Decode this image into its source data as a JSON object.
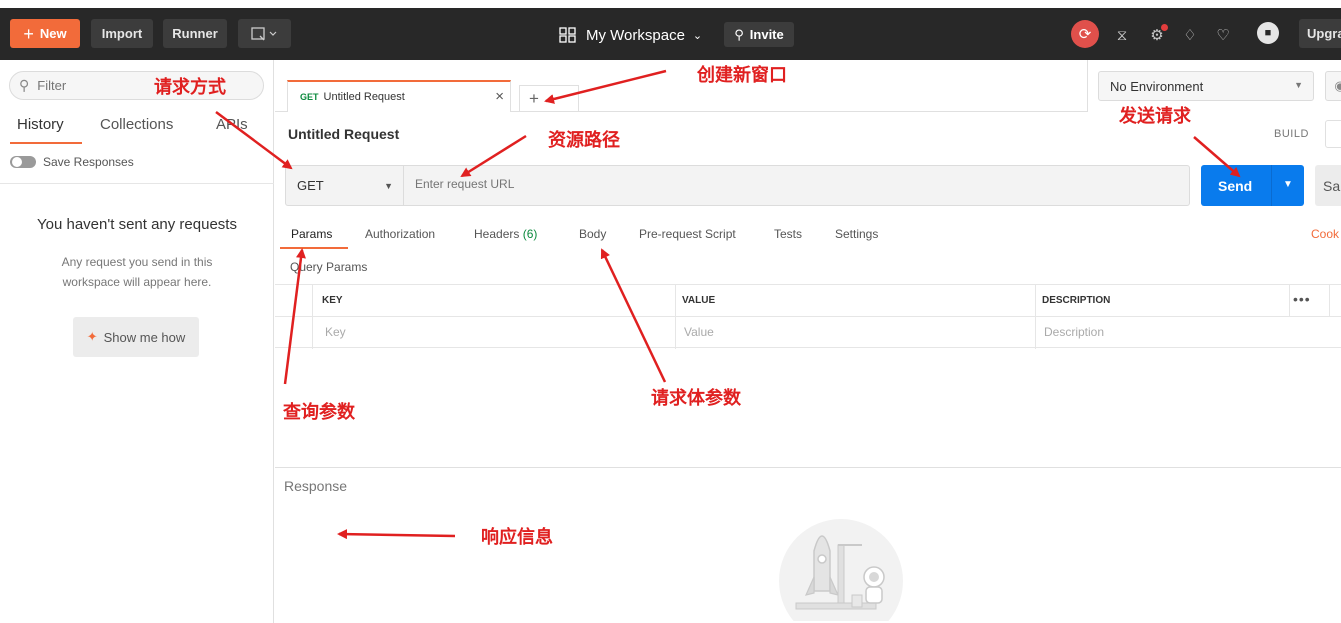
{
  "header": {
    "new_label": "New",
    "import_label": "Import",
    "runner_label": "Runner",
    "workspace_label": "My Workspace",
    "invite_label": "Invite",
    "upgrade_label": "Upgra"
  },
  "sidebar": {
    "filter_placeholder": "Filter",
    "tabs": [
      "History",
      "Collections",
      "APIs"
    ],
    "save_responses_label": "Save Responses",
    "empty_title": "You haven't sent any requests",
    "empty_desc": "Any request you send in this workspace will appear here.",
    "show_me_label": "Show me how"
  },
  "request_tab": {
    "method": "GET",
    "title": "Untitled Request"
  },
  "environment": {
    "selected": "No Environment"
  },
  "request": {
    "name": "Untitled Request",
    "build_label": "BUILD",
    "method": "GET",
    "url_placeholder": "Enter request URL",
    "send_label": "Send",
    "save_label": "Sa"
  },
  "param_tabs": {
    "params": "Params",
    "authorization": "Authorization",
    "headers": "Headers",
    "headers_count": "(6)",
    "body": "Body",
    "prerequest": "Pre-request Script",
    "tests": "Tests",
    "settings": "Settings",
    "cookies": "Cook"
  },
  "query_params": {
    "title": "Query Params",
    "columns": [
      "KEY",
      "VALUE",
      "DESCRIPTION"
    ],
    "placeholders": [
      "Key",
      "Value",
      "Description"
    ]
  },
  "response": {
    "label": "Response"
  },
  "annotations": {
    "method": "请求方式",
    "new_window": "创建新窗口",
    "resource_path": "资源路径",
    "send_request": "发送请求",
    "query_params": "查询参数",
    "body_params": "请求体参数",
    "response_info": "响应信息"
  },
  "colors": {
    "accent": "#f26b3a",
    "send_blue": "#097bed",
    "annotation_red": "#e02020"
  }
}
